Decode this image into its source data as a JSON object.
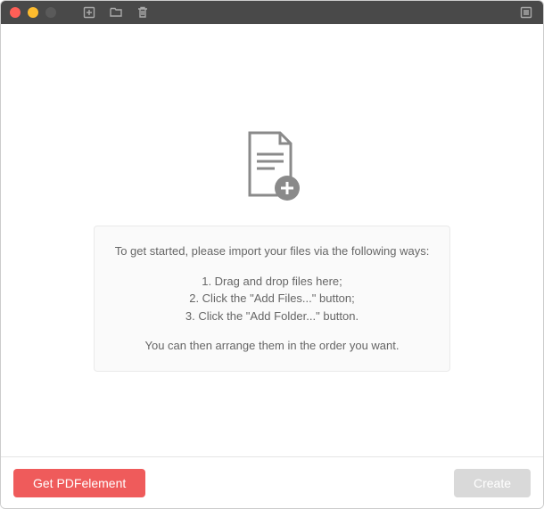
{
  "instructions": {
    "intro": "To get started, please import your files via the following ways:",
    "step1": "1. Drag and drop files here;",
    "step2": "2. Click the \"Add Files...\" button;",
    "step3": "3. Click the \"Add Folder...\" button.",
    "outro": "You can then arrange them in the order you want."
  },
  "footer": {
    "get_label": "Get PDFelement",
    "create_label": "Create"
  }
}
